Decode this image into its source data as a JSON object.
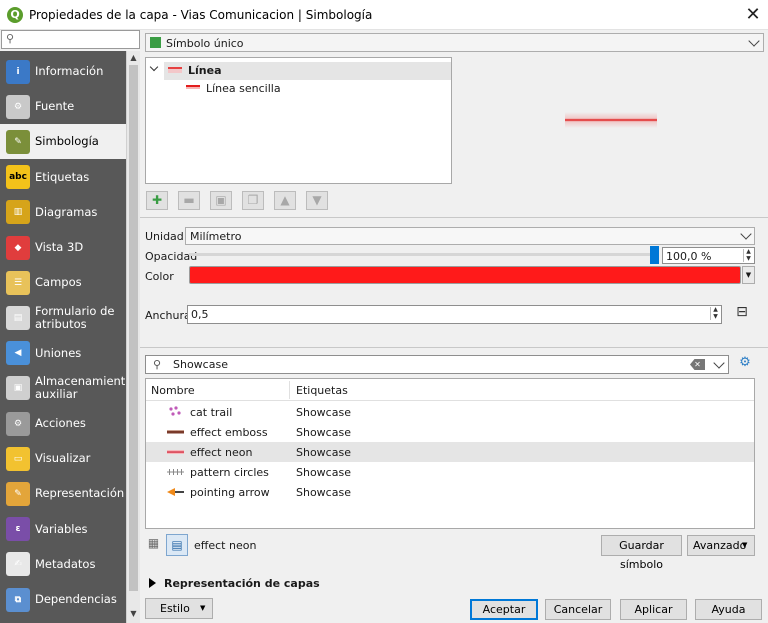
{
  "window": {
    "title": "Propiedades de la capa - Vias Comunicacion | Simbología",
    "app_icon": "qgis-q-icon",
    "close": "✕"
  },
  "sidebar": {
    "search_icon": "search-icon",
    "items": [
      {
        "id": "informacion",
        "label": "Información",
        "icon": "info-icon",
        "color": "#3b79c7"
      },
      {
        "id": "fuente",
        "label": "Fuente",
        "icon": "source-wrench-icon",
        "color": "#c9c9c9"
      },
      {
        "id": "simbologia",
        "label": "Simbología",
        "icon": "symbology-brush-icon",
        "color": "#7b8f3a",
        "active": true
      },
      {
        "id": "etiquetas",
        "label": "Etiquetas",
        "icon": "labels-abc-icon",
        "color": "#f3c21a"
      },
      {
        "id": "diagramas",
        "label": "Diagramas",
        "icon": "diagrams-icon",
        "color": "#d6a41a"
      },
      {
        "id": "vista3d",
        "label": "Vista 3D",
        "icon": "cube-3d-icon",
        "color": "#e03d3d"
      },
      {
        "id": "campos",
        "label": "Campos",
        "icon": "fields-icon",
        "color": "#e8c25a"
      },
      {
        "id": "formulario",
        "label": "Formulario de atributos",
        "icon": "form-icon",
        "color": "#d8d8d8"
      },
      {
        "id": "uniones",
        "label": "Uniones",
        "icon": "joins-icon",
        "color": "#4a90d9"
      },
      {
        "id": "almacenamiento",
        "label": "Almacenamiento auxiliar",
        "icon": "auxiliary-storage-icon",
        "color": "#cfcfcf"
      },
      {
        "id": "acciones",
        "label": "Acciones",
        "icon": "actions-gear-icon",
        "color": "#9a9a9a"
      },
      {
        "id": "visualizar",
        "label": "Visualizar",
        "icon": "display-speech-icon",
        "color": "#f2c230"
      },
      {
        "id": "representacion",
        "label": "Representación",
        "icon": "rendering-brush-icon",
        "color": "#e3a53a"
      },
      {
        "id": "variables",
        "label": "Variables",
        "icon": "variables-icon",
        "color": "#7a4ea8"
      },
      {
        "id": "metadatos",
        "label": "Metadatos",
        "icon": "metadata-icon",
        "color": "#e8e8e8"
      },
      {
        "id": "dependencias",
        "label": "Dependencias",
        "icon": "dependencies-icon",
        "color": "#5b8fd0"
      }
    ]
  },
  "renderer": {
    "selected": "Símbolo único"
  },
  "symbol_tree": {
    "root": "Línea",
    "child": "Línea sencilla"
  },
  "symbol_toolbar": [
    "add-layer-icon",
    "remove-layer-icon",
    "lock-icon",
    "duplicate-icon",
    "move-up-icon",
    "move-down-icon"
  ],
  "props": {
    "unit_label": "Unidad",
    "unit_value": "Milímetro",
    "opacity_label": "Opacidad",
    "opacity_value": "100,0 %",
    "opacity_level": 1.0,
    "color_label": "Color",
    "color_value": "#ff1a1a",
    "width_label": "Anchura",
    "width_value": "0,5"
  },
  "library": {
    "search_value": "Showcase",
    "columns": [
      "Nombre",
      "Etiquetas"
    ],
    "rows": [
      {
        "name": "cat trail",
        "tag": "Showcase",
        "icon": "cat-trail-icon"
      },
      {
        "name": "effect emboss",
        "tag": "Showcase",
        "icon": "effect-emboss-icon"
      },
      {
        "name": "effect neon",
        "tag": "Showcase",
        "icon": "effect-neon-icon",
        "selected": true
      },
      {
        "name": "pattern circles",
        "tag": "Showcase",
        "icon": "pattern-circles-icon"
      },
      {
        "name": "pointing arrow",
        "tag": "Showcase",
        "icon": "pointing-arrow-icon"
      }
    ],
    "selected_name": "effect neon",
    "save_button": "Guardar símbolo",
    "advanced_button": "Avanzado"
  },
  "layer_rendering": {
    "label": "Representación de capas"
  },
  "footer": {
    "style_button": "Estilo",
    "accept": "Aceptar",
    "cancel": "Cancelar",
    "apply": "Aplicar",
    "help": "Ayuda"
  }
}
